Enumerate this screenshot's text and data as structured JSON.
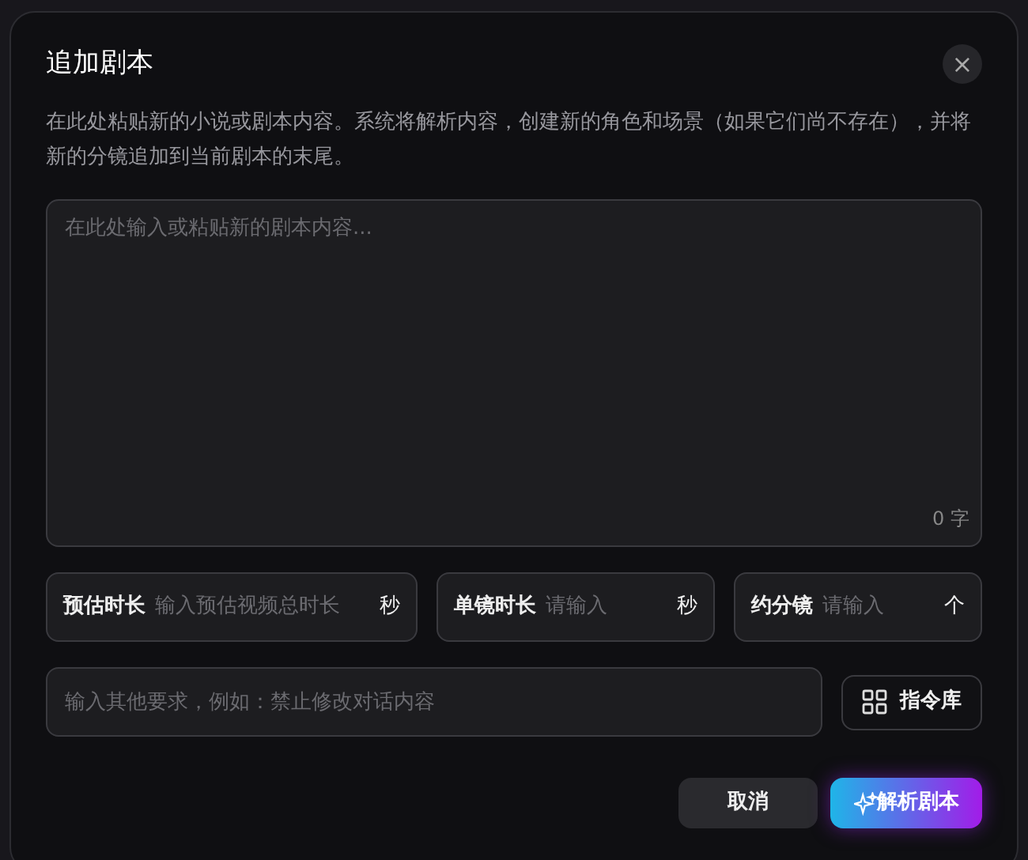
{
  "dialog": {
    "title": "追加剧本",
    "close": "×",
    "description": "在此处粘贴新的小说或剧本内容。系统将解析内容，创建新的角色和场景（如果它们尚不存在），并将新的分镜追加到当前剧本的末尾。"
  },
  "script_input": {
    "placeholder": "在此处输入或粘贴新的剧本内容...",
    "counter": "0 字"
  },
  "fields": [
    {
      "label": "预估时长",
      "placeholder": "输入预估视频总时长",
      "unit": "秒"
    },
    {
      "label": "单镜时长",
      "placeholder": "请输入",
      "unit": "秒"
    },
    {
      "label": "约分镜",
      "placeholder": "请输入",
      "unit": "个"
    }
  ],
  "requirements": {
    "placeholder": "输入其他要求，例如：禁止修改对话内容"
  },
  "library_button": "指令库",
  "buttons": [
    {
      "kind": "secondary",
      "label": "取消"
    },
    {
      "kind": "primary",
      "label": "解析剧本"
    }
  ]
}
